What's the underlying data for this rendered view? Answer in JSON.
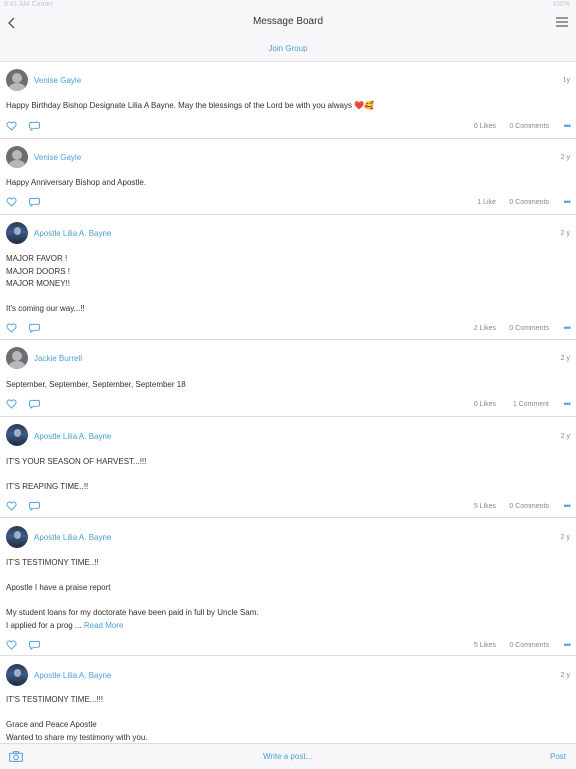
{
  "status_bar": {
    "left": "9:41 AM   Carrier",
    "right": "100%"
  },
  "header": {
    "title": "Message Board"
  },
  "join_group": "Join Group",
  "posts": [
    {
      "author": "Venise Gayle",
      "age": "1y",
      "avatar": "default",
      "lines": [
        "Happy Birthday Bishop Designate Lilia A Bayne. May the blessings of the Lord be with you always"
      ],
      "emoji": "❤️🥰",
      "likes": "0 Likes",
      "comments": "0 Comments"
    },
    {
      "author": "Venise Gayle",
      "age": "2 y",
      "avatar": "default",
      "lines": [
        "Happy Anniversary Bishop and Apostle."
      ],
      "likes": "1 Like",
      "comments": "0 Comments"
    },
    {
      "author": "Apostle Lilia A. Bayne",
      "age": "2 y",
      "avatar": "photo",
      "lines": [
        "MAJOR FAVOR !",
        "MAJOR DOORS !",
        "MAJOR MONEY!!",
        "",
        "It's coming our way...!!"
      ],
      "likes": "2 Likes",
      "comments": "0 Comments"
    },
    {
      "author": "Jackie Burrell",
      "age": "2 y",
      "avatar": "default",
      "lines": [
        "September, September, September, September 18"
      ],
      "likes": "0 Likes",
      "comments": "1 Comment"
    },
    {
      "author": "Apostle Lilia A. Bayne",
      "age": "2 y",
      "avatar": "photo",
      "lines": [
        "IT'S YOUR SEASON OF HARVEST...!!!",
        "",
        "IT'S REAPING TIME..!!"
      ],
      "likes": "5 Likes",
      "comments": "0 Comments"
    },
    {
      "author": "Apostle Lilia A. Bayne",
      "age": "2 y",
      "avatar": "photo",
      "lines": [
        "IT'S TESTIMONY TIME..!!",
        "",
        "Apostle I have a praise report",
        "",
        "My student loans for my doctorate have been paid in full by Uncle Sam.",
        "I applied for a prog ..."
      ],
      "read_more": "Read More",
      "likes": "5 Likes",
      "comments": "0 Comments"
    },
    {
      "author": "Apostle Lilia A. Bayne",
      "age": "2 y",
      "avatar": "photo",
      "lines": [
        "IT'S TESTIMONY TIME...!!!",
        "",
        "Grace and Peace Apostle",
        "Wanted to share my testimony with you."
      ]
    }
  ],
  "more_dots": "•••",
  "footer": {
    "write_post": "Write a post...",
    "post_button": "Post"
  }
}
